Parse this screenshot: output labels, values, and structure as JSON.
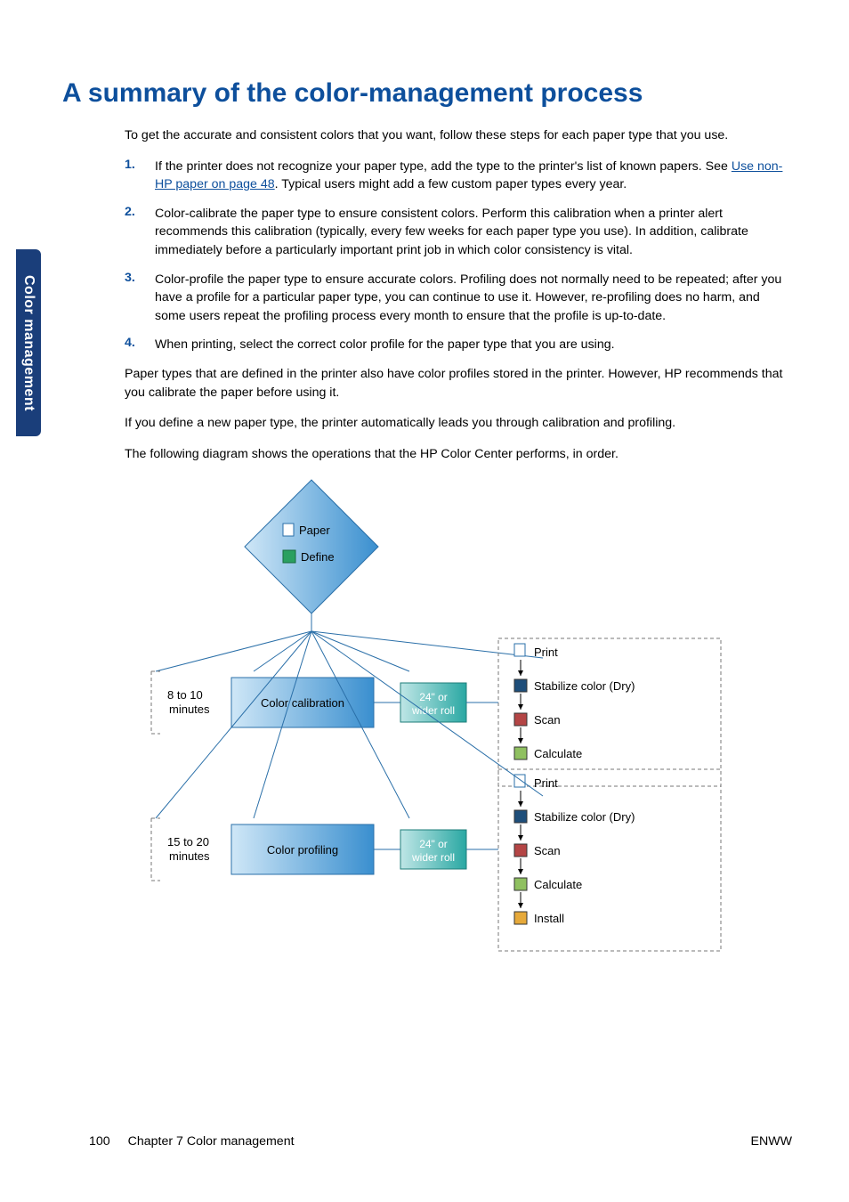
{
  "sideTab": "Color management",
  "heading": "A summary of the color-management process",
  "intro": "To get the accurate and consistent colors that you want, follow these steps for each paper type that you use.",
  "steps": [
    {
      "num": "1.",
      "pre": "If the printer does not recognize your paper type, add the type to the printer's list of known papers. See ",
      "link": "Use non-HP paper on page 48",
      "post": ". Typical users might add a few custom paper types every year."
    },
    {
      "num": "2.",
      "text": "Color-calibrate the paper type to ensure consistent colors. Perform this calibration when a printer alert recommends this calibration (typically, every few weeks for each paper type you use). In addition, calibrate immediately before a particularly important print job in which color consistency is vital."
    },
    {
      "num": "3.",
      "text": "Color-profile the paper type to ensure accurate colors. Profiling does not normally need to be repeated; after you have a profile for a particular paper type, you can continue to use it. However, re-profiling does no harm, and some users repeat the profiling process every month to ensure that the profile is up-to-date."
    },
    {
      "num": "4.",
      "text": "When printing, select the correct color profile for the paper type that you are using."
    }
  ],
  "para1": "Paper types that are defined in the printer also have color profiles stored in the printer. However, HP recommends that you calibrate the paper before using it.",
  "para2": "If you define a new paper type, the printer automatically leads you through calibration and profiling.",
  "para3": "The following diagram shows the operations that the HP Color Center performs, in order.",
  "diagram": {
    "paper": "Paper",
    "define": "Define",
    "calib_time": "8 to 10\nminutes",
    "calib_box": "Color calibration",
    "prof_time": "15 to 20\nminutes",
    "prof_box": "Color profiling",
    "roll": "24\" or\nwider roll",
    "calib_steps": [
      "Print",
      "Stabilize color (Dry)",
      "Scan",
      "Calculate"
    ],
    "calib_colors": [
      "#2f6fb0",
      "#1e4e7a",
      "#b44545",
      "#8fc060"
    ],
    "prof_steps": [
      "Print",
      "Stabilize color (Dry)",
      "Scan",
      "Calculate",
      "Install"
    ],
    "prof_colors": [
      "#2f6fb0",
      "#1e4e7a",
      "#b44545",
      "#8fc060",
      "#e6a93a"
    ]
  },
  "footer": {
    "page": "100",
    "chapter": "Chapter 7   Color management",
    "right": "ENWW"
  }
}
